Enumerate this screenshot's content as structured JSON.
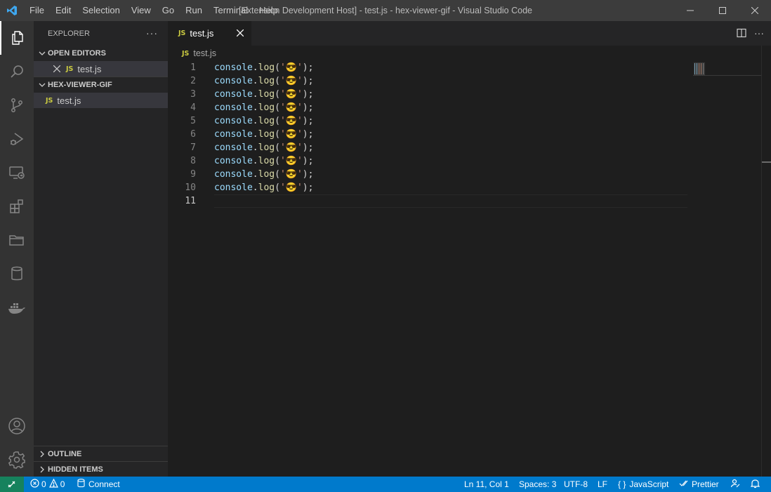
{
  "titlebar": {
    "title": "[Extension Development Host] - test.js - hex-viewer-gif - Visual Studio Code",
    "menu": [
      "File",
      "Edit",
      "Selection",
      "View",
      "Go",
      "Run",
      "Terminal",
      "Help"
    ]
  },
  "sidebar": {
    "header": "EXPLORER",
    "open_editors_title": "OPEN EDITORS",
    "open_editor_file": "test.js",
    "folder_title": "HEX-VIEWER-GIF",
    "folder_file": "test.js",
    "outline_title": "OUTLINE",
    "hidden_title": "HIDDEN ITEMS",
    "file_badge": "JS"
  },
  "editor": {
    "tab_label": "test.js",
    "breadcrumb": "test.js",
    "lines": [
      {
        "num": "1",
        "obj": "console",
        "dot": ".",
        "fn": "log",
        "open": "(",
        "str": "'😎'",
        "close": ");"
      },
      {
        "num": "2",
        "obj": "console",
        "dot": ".",
        "fn": "log",
        "open": "(",
        "str": "'😎'",
        "close": ");"
      },
      {
        "num": "3",
        "obj": "console",
        "dot": ".",
        "fn": "log",
        "open": "(",
        "str": "'😎'",
        "close": ");"
      },
      {
        "num": "4",
        "obj": "console",
        "dot": ".",
        "fn": "log",
        "open": "(",
        "str": "'😎'",
        "close": ");"
      },
      {
        "num": "5",
        "obj": "console",
        "dot": ".",
        "fn": "log",
        "open": "(",
        "str": "'😎'",
        "close": ");"
      },
      {
        "num": "6",
        "obj": "console",
        "dot": ".",
        "fn": "log",
        "open": "(",
        "str": "'😎'",
        "close": ");"
      },
      {
        "num": "7",
        "obj": "console",
        "dot": ".",
        "fn": "log",
        "open": "(",
        "str": "'😎'",
        "close": ");"
      },
      {
        "num": "8",
        "obj": "console",
        "dot": ".",
        "fn": "log",
        "open": "(",
        "str": "'😎'",
        "close": ");"
      },
      {
        "num": "9",
        "obj": "console",
        "dot": ".",
        "fn": "log",
        "open": "(",
        "str": "'😎'",
        "close": ");"
      },
      {
        "num": "10",
        "obj": "console",
        "dot": ".",
        "fn": "log",
        "open": "(",
        "str": "'😎'",
        "close": ");"
      }
    ],
    "current_line_num": "11"
  },
  "statusbar": {
    "errors": "0",
    "warnings": "0",
    "connect": "Connect",
    "position": "Ln 11, Col 1",
    "spaces": "Spaces: 3",
    "encoding": "UTF-8",
    "eol": "LF",
    "language_braces": "{ }",
    "language": "JavaScript",
    "formatter": "Prettier"
  },
  "colors": {
    "accent": "#007acc",
    "remote": "#16825d",
    "js_icon": "#cbcb41"
  },
  "icons": {
    "activity_bar": [
      "explorer-icon",
      "search-icon",
      "source-control-icon",
      "run-debug-icon",
      "remote-explorer-icon",
      "extensions-icon",
      "folder-icon",
      "database-icon",
      "docker-icon",
      "account-icon",
      "settings-gear-icon"
    ]
  }
}
